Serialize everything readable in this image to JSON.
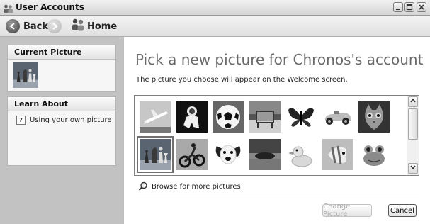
{
  "window": {
    "title": "User Accounts"
  },
  "toolbar": {
    "back_label": "Back",
    "home_label": "Home"
  },
  "sidebar": {
    "current_picture_header": "Current Picture",
    "learn_about_header": "Learn About",
    "learn_items": [
      {
        "label": "Using your own picture",
        "icon": "help-icon"
      }
    ]
  },
  "main": {
    "heading": "Pick a new picture for Chronos's account",
    "subtext": "The picture you choose will appear on the Welcome screen.",
    "pictures": [
      {
        "name": "airplane"
      },
      {
        "name": "astronaut"
      },
      {
        "name": "soccer-ball"
      },
      {
        "name": "beach-chair"
      },
      {
        "name": "butterfly"
      },
      {
        "name": "race-car"
      },
      {
        "name": "cat"
      },
      {
        "name": "chess",
        "selected": true
      },
      {
        "name": "dirt-bike"
      },
      {
        "name": "dog"
      },
      {
        "name": "horses"
      },
      {
        "name": "rubber-duck"
      },
      {
        "name": "fish"
      },
      {
        "name": "frog"
      }
    ],
    "browse_label": "Browse for more pictures",
    "change_button": "Change Picture",
    "cancel_button": "Cancel"
  }
}
